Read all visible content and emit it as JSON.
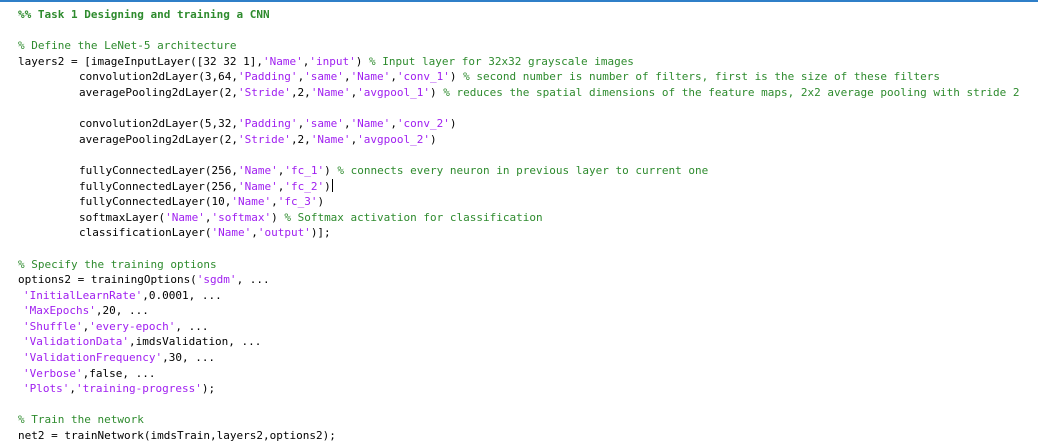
{
  "colors": {
    "keyword": "#000000",
    "comment": "#2e8b2e",
    "string": "#a020f0",
    "focus_border": "#2f7fc8"
  },
  "lines": [
    {
      "indent": 0,
      "tokens": [
        [
          "cmb",
          "%% Task 1 Designing and training a CNN"
        ]
      ]
    },
    {
      "indent": 0,
      "tokens": []
    },
    {
      "indent": 0,
      "tokens": [
        [
          "cm",
          "% Define the LeNet-5 architecture"
        ]
      ]
    },
    {
      "indent": 0,
      "tokens": [
        [
          "t",
          "layers2 = [imageInputLayer([32 32 1],"
        ],
        [
          "st",
          "'Name'"
        ],
        [
          "t",
          ","
        ],
        [
          "st",
          "'input'"
        ],
        [
          "t",
          ") "
        ],
        [
          "cm",
          "% Input layer for 32x32 grayscale images"
        ]
      ]
    },
    {
      "indent": 1,
      "tokens": [
        [
          "t",
          "convolution2dLayer(3,64,"
        ],
        [
          "st",
          "'Padding'"
        ],
        [
          "t",
          ","
        ],
        [
          "st",
          "'same'"
        ],
        [
          "t",
          ","
        ],
        [
          "st",
          "'Name'"
        ],
        [
          "t",
          ","
        ],
        [
          "st",
          "'conv_1'"
        ],
        [
          "t",
          ") "
        ],
        [
          "cm",
          "% second number is number of filters, first is the size of these filters"
        ]
      ]
    },
    {
      "indent": 1,
      "tokens": [
        [
          "t",
          "averagePooling2dLayer(2,"
        ],
        [
          "st",
          "'Stride'"
        ],
        [
          "t",
          ",2,"
        ],
        [
          "st",
          "'Name'"
        ],
        [
          "t",
          ","
        ],
        [
          "st",
          "'avgpool_1'"
        ],
        [
          "t",
          ") "
        ],
        [
          "cm",
          "% reduces the spatial dimensions of the feature maps, 2x2 average pooling with stride 2"
        ]
      ]
    },
    {
      "indent": 0,
      "tokens": []
    },
    {
      "indent": 1,
      "tokens": [
        [
          "t",
          "convolution2dLayer(5,32,"
        ],
        [
          "st",
          "'Padding'"
        ],
        [
          "t",
          ","
        ],
        [
          "st",
          "'same'"
        ],
        [
          "t",
          ","
        ],
        [
          "st",
          "'Name'"
        ],
        [
          "t",
          ","
        ],
        [
          "st",
          "'conv_2'"
        ],
        [
          "t",
          ")"
        ]
      ]
    },
    {
      "indent": 1,
      "tokens": [
        [
          "t",
          "averagePooling2dLayer(2,"
        ],
        [
          "st",
          "'Stride'"
        ],
        [
          "t",
          ",2,"
        ],
        [
          "st",
          "'Name'"
        ],
        [
          "t",
          ","
        ],
        [
          "st",
          "'avgpool_2'"
        ],
        [
          "t",
          ")"
        ]
      ]
    },
    {
      "indent": 0,
      "tokens": []
    },
    {
      "indent": 1,
      "tokens": [
        [
          "t",
          "fullyConnectedLayer(256,"
        ],
        [
          "st",
          "'Name'"
        ],
        [
          "t",
          ","
        ],
        [
          "st",
          "'fc_1'"
        ],
        [
          "t",
          ") "
        ],
        [
          "cm",
          "% connects every neuron in previous layer to current one"
        ]
      ]
    },
    {
      "indent": 1,
      "caret": true,
      "tokens": [
        [
          "t",
          "fullyConnectedLayer(256,"
        ],
        [
          "st",
          "'Name'"
        ],
        [
          "t",
          ","
        ],
        [
          "st",
          "'fc_2'"
        ],
        [
          "t",
          ")"
        ]
      ]
    },
    {
      "indent": 1,
      "tokens": [
        [
          "t",
          "fullyConnectedLayer(10,"
        ],
        [
          "st",
          "'Name'"
        ],
        [
          "t",
          ","
        ],
        [
          "st",
          "'fc_3'"
        ],
        [
          "t",
          ")"
        ]
      ]
    },
    {
      "indent": 1,
      "tokens": [
        [
          "t",
          "softmaxLayer("
        ],
        [
          "st",
          "'Name'"
        ],
        [
          "t",
          ","
        ],
        [
          "st",
          "'softmax'"
        ],
        [
          "t",
          ") "
        ],
        [
          "cm",
          "% Softmax activation for classification"
        ]
      ]
    },
    {
      "indent": 1,
      "tokens": [
        [
          "t",
          "classificationLayer("
        ],
        [
          "st",
          "'Name'"
        ],
        [
          "t",
          ","
        ],
        [
          "st",
          "'output'"
        ],
        [
          "t",
          ")];"
        ]
      ]
    },
    {
      "indent": 0,
      "tokens": []
    },
    {
      "indent": 0,
      "tokens": [
        [
          "cm",
          "% Specify the training options"
        ]
      ]
    },
    {
      "indent": 0,
      "tokens": [
        [
          "t",
          "options2 = trainingOptions("
        ],
        [
          "st",
          "'sgdm'"
        ],
        [
          "t",
          ", ..."
        ]
      ]
    },
    {
      "indent": 2,
      "tokens": [
        [
          "st",
          "'InitialLearnRate'"
        ],
        [
          "t",
          ",0.0001, ..."
        ]
      ]
    },
    {
      "indent": 2,
      "tokens": [
        [
          "st",
          "'MaxEpochs'"
        ],
        [
          "t",
          ",20, ..."
        ]
      ]
    },
    {
      "indent": 2,
      "tokens": [
        [
          "st",
          "'Shuffle'"
        ],
        [
          "t",
          ","
        ],
        [
          "st",
          "'every-epoch'"
        ],
        [
          "t",
          ", ..."
        ]
      ]
    },
    {
      "indent": 2,
      "tokens": [
        [
          "st",
          "'ValidationData'"
        ],
        [
          "t",
          ",imdsValidation, ..."
        ]
      ]
    },
    {
      "indent": 2,
      "tokens": [
        [
          "st",
          "'ValidationFrequency'"
        ],
        [
          "t",
          ",30, ..."
        ]
      ]
    },
    {
      "indent": 2,
      "tokens": [
        [
          "st",
          "'Verbose'"
        ],
        [
          "t",
          ",false, ..."
        ]
      ]
    },
    {
      "indent": 2,
      "tokens": [
        [
          "st",
          "'Plots'"
        ],
        [
          "t",
          ","
        ],
        [
          "st",
          "'training-progress'"
        ],
        [
          "t",
          ");"
        ]
      ]
    },
    {
      "indent": 0,
      "tokens": []
    },
    {
      "indent": 0,
      "tokens": [
        [
          "cm",
          "% Train the network"
        ]
      ]
    },
    {
      "indent": 0,
      "tokens": [
        [
          "t",
          "net2 = trainNetwork(imdsTrain,layers2,options2);"
        ]
      ]
    }
  ]
}
